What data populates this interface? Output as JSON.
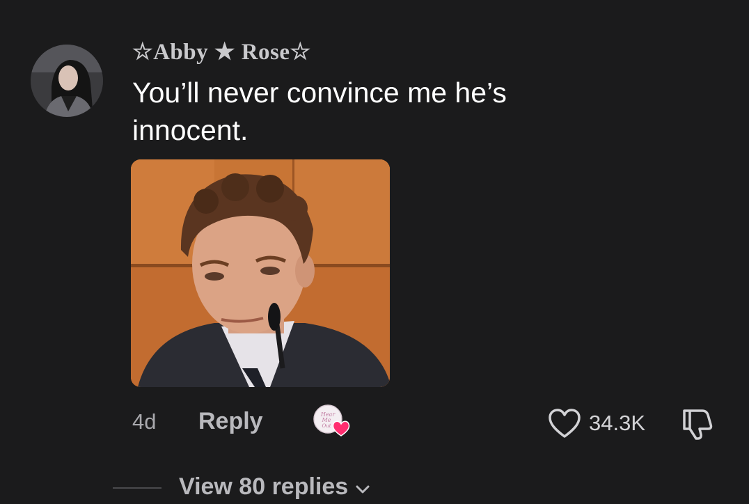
{
  "comment": {
    "username": "☆Abby ★ Rose☆",
    "text": "You’ll never convince me he’s innocent.",
    "time": "4d",
    "reply_label": "Reply",
    "like_count": "34.3K",
    "view_replies_label": "View 80 replies"
  },
  "icons": {
    "like": "heart-outline-icon",
    "dislike": "thumbs-down-icon",
    "expand": "chevron-down-icon",
    "creator_liked": "creator-heart-badge-icon"
  },
  "colors": {
    "background": "#1b1b1c",
    "heart_badge": "#ff2d6f",
    "secondary_text": "#a9a9ad"
  }
}
